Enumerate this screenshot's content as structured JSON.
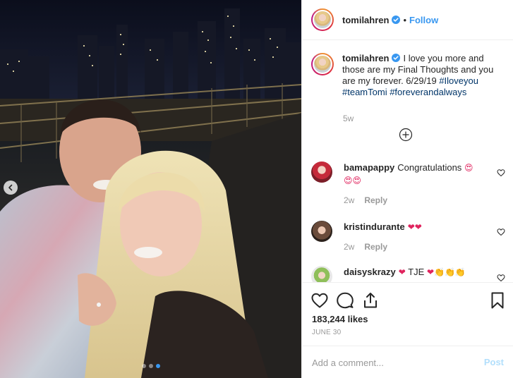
{
  "post": {
    "username": "tomilahren",
    "follow_label": "Follow",
    "separator": "•",
    "caption": {
      "username": "tomilahren",
      "text": "I love you more and those are my Final Thoughts and you are my forever. 6/29/19",
      "hashtags": [
        "#Iloveyou",
        "#teamTomi",
        "#foreverandalways"
      ],
      "time": "5w"
    },
    "comments": [
      {
        "username": "bamapappy",
        "text": "Congratulations",
        "emoji": "😍",
        "emoji_line2": "😍😍",
        "time": "2w",
        "reply_label": "Reply"
      },
      {
        "username": "kristindurante",
        "text": "",
        "emoji": "❤❤",
        "time": "2w",
        "reply_label": "Reply"
      },
      {
        "username": "daisyskrazy",
        "text_before": "❤",
        "text_mid": "TJE",
        "text_after": "❤",
        "emoji_tail": "👏👏👏"
      }
    ],
    "likes": "183,244 likes",
    "date": "JUNE 30",
    "add_comment_placeholder": "Add a comment...",
    "post_label": "Post",
    "carousel": {
      "slides": 3,
      "active": 3
    }
  },
  "colors": {
    "accent": "#3897f0",
    "hashtag": "#003569",
    "muted": "#999999",
    "post_disabled": "#b2dffc"
  },
  "icons": [
    "verified-icon",
    "add-comments-icon",
    "heart-icon",
    "comment-icon",
    "share-icon",
    "bookmark-icon",
    "chevron-left-icon"
  ]
}
